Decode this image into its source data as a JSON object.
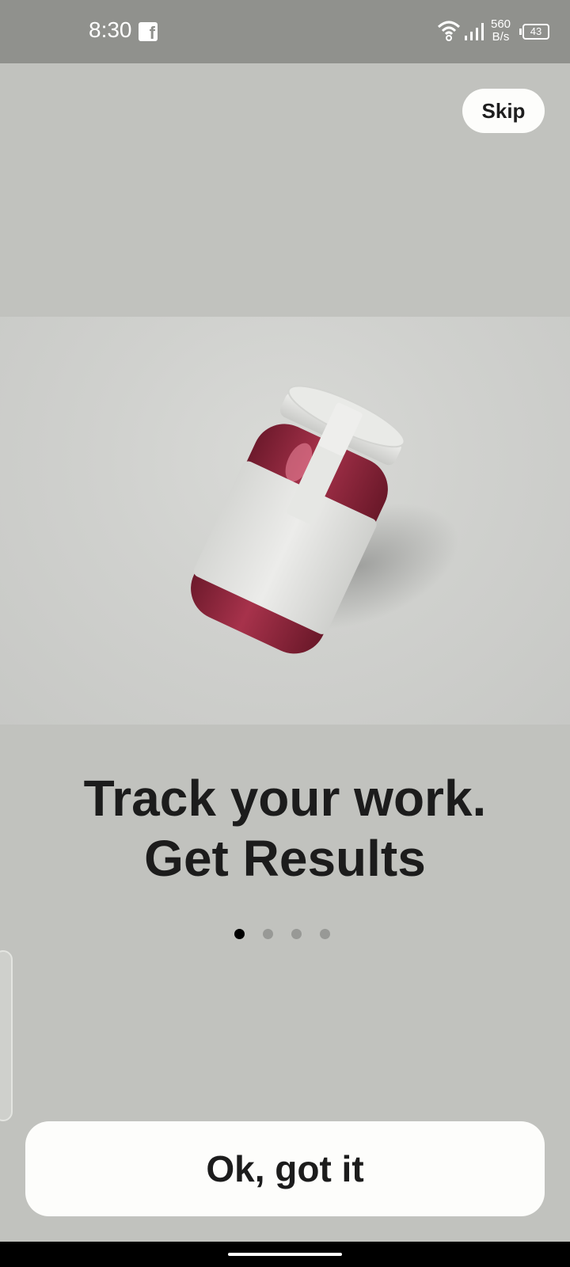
{
  "status_bar": {
    "time": "8:30",
    "notification_icon": "facebook-icon",
    "network_speed_value": "560",
    "network_speed_unit": "B/s",
    "battery_level": "43",
    "icons": [
      "wifi-icon",
      "signal-icon",
      "battery-icon"
    ]
  },
  "onboarding": {
    "skip_label": "Skip",
    "hero_image": "jam-jar-illustration",
    "headline_line1": "Track your work.",
    "headline_line2": "Get Results",
    "page_count": 4,
    "current_page": 1,
    "primary_button_label": "Ok, got it"
  },
  "colors": {
    "background": "#c1c2be",
    "status_bar": "#90918d",
    "button_fill": "#fdfdfb",
    "text": "#1c1c1c",
    "dot_active": "#000000",
    "dot_inactive": "#989996",
    "jar_fill": "#8c2439"
  }
}
